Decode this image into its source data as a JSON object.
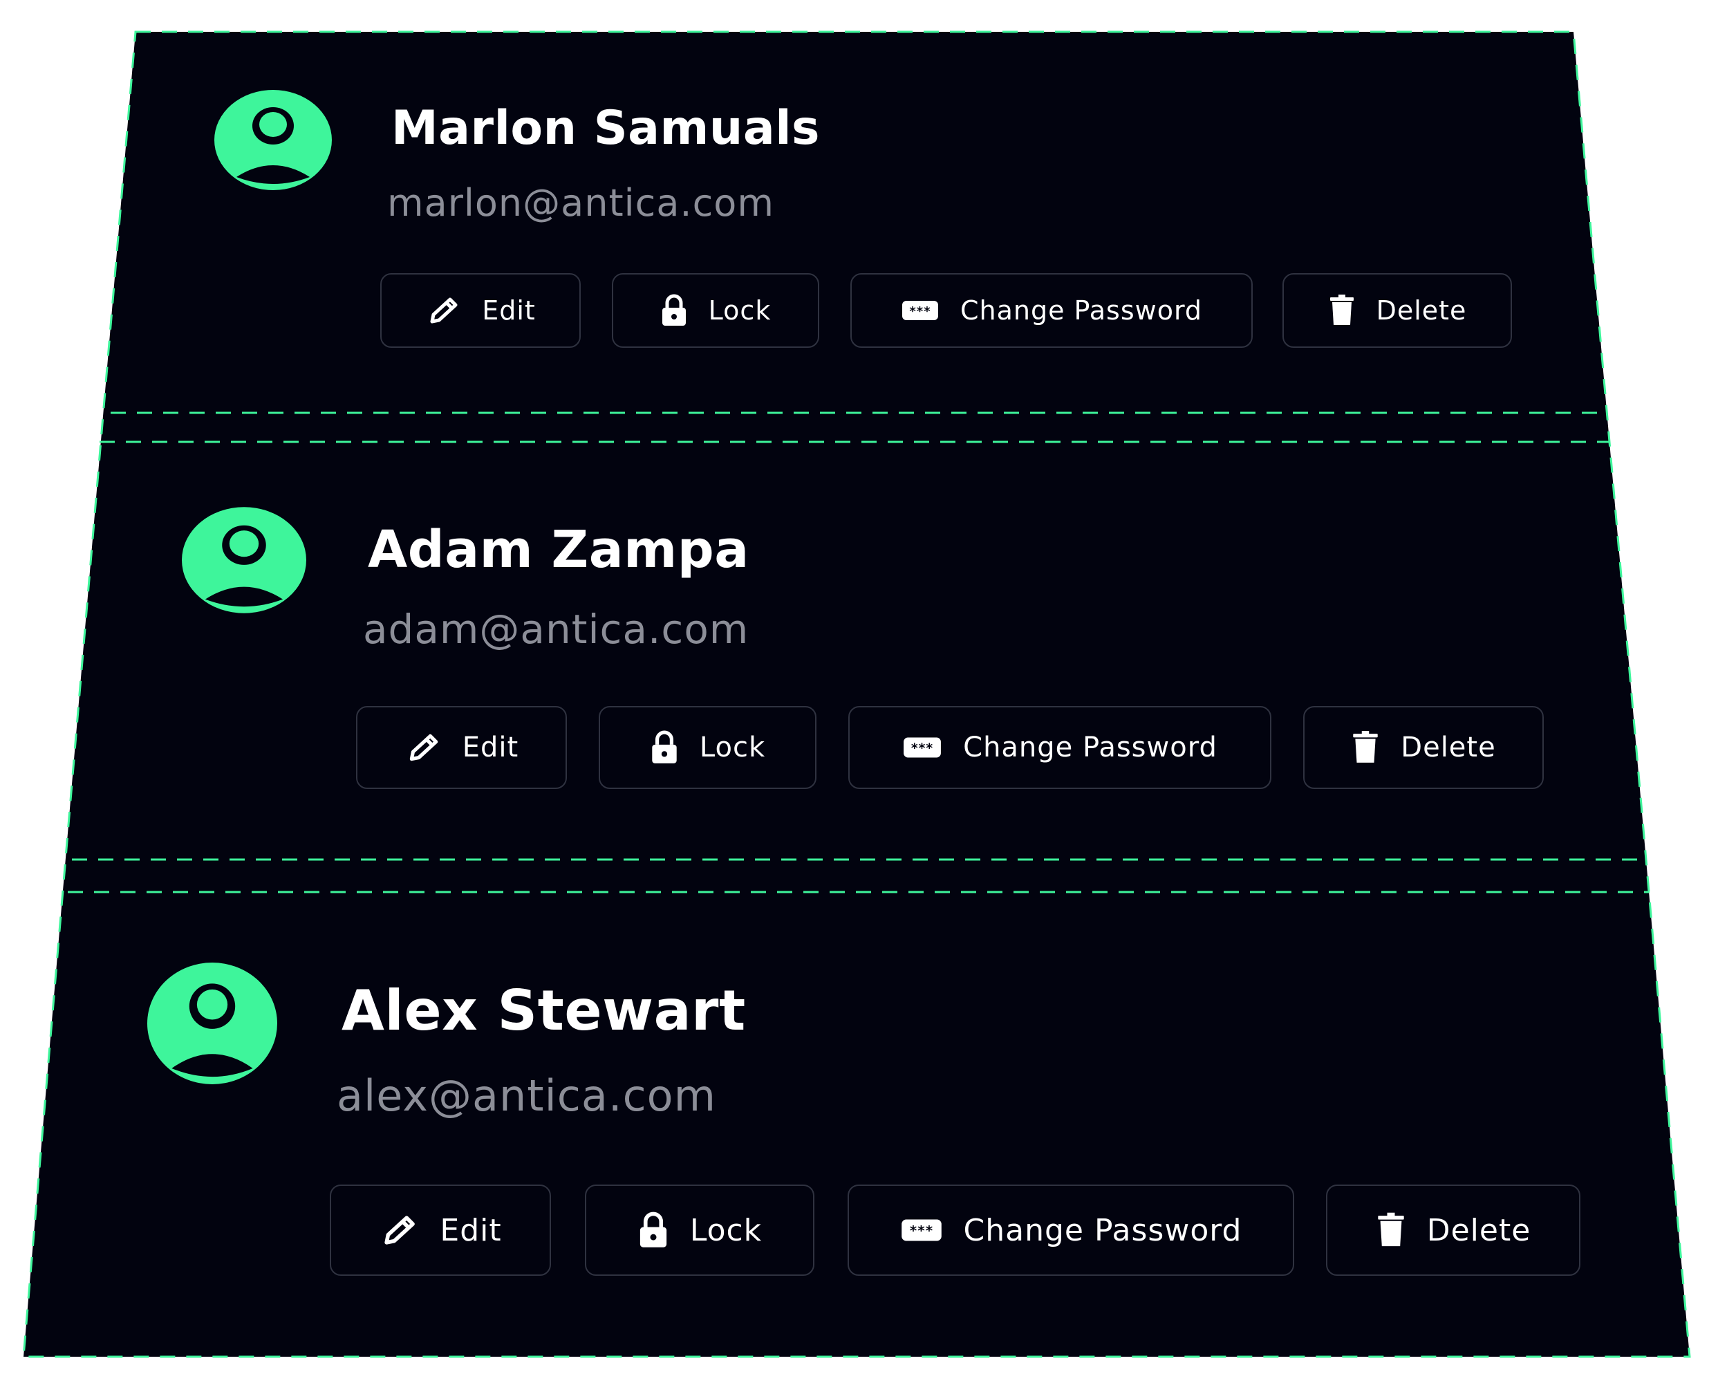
{
  "theme": {
    "background": "#02030f",
    "accent": "#3ef59b",
    "text": "#ffffff",
    "muted": "#8c8e98",
    "border": "#2f3240"
  },
  "users": [
    {
      "name": "Marlon Samuals",
      "email": "marlon@antica.com",
      "avatar_icon": "user-avatar-icon",
      "actions": {
        "edit": "Edit",
        "lock": "Lock",
        "change_password": "Change Password",
        "delete": "Delete"
      }
    },
    {
      "name": "Adam Zampa",
      "email": "adam@antica.com",
      "avatar_icon": "user-avatar-icon",
      "actions": {
        "edit": "Edit",
        "lock": "Lock",
        "change_password": "Change Password",
        "delete": "Delete"
      }
    },
    {
      "name": "Alex Stewart",
      "email": "alex@antica.com",
      "avatar_icon": "user-avatar-icon",
      "actions": {
        "edit": "Edit",
        "lock": "Lock",
        "change_password": "Change Password",
        "delete": "Delete"
      }
    }
  ],
  "icons": {
    "edit": "pencil-icon",
    "lock": "lock-icon",
    "change_password": "password-icon",
    "delete": "trash-icon"
  }
}
